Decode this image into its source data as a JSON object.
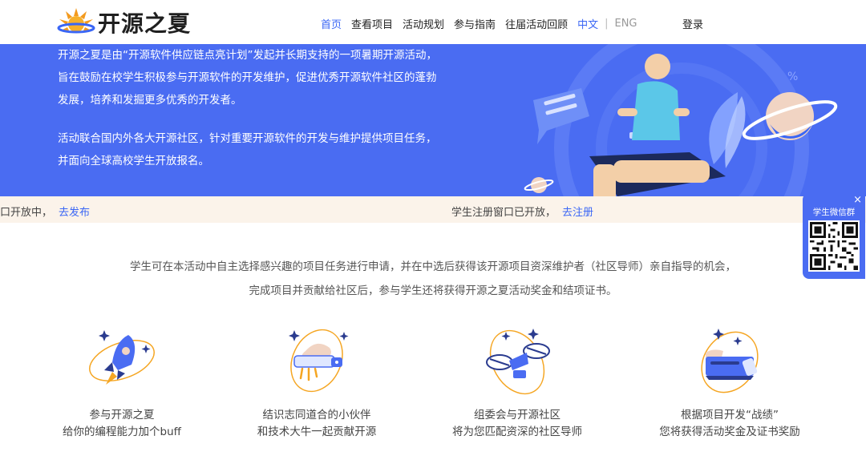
{
  "header": {
    "logo_text": "开源之夏",
    "nav": [
      "首页",
      "查看项目",
      "活动规划",
      "参与指南",
      "往届活动回顾"
    ],
    "active_index": 0,
    "lang_zh": "中文",
    "lang_sep": "|",
    "lang_en": "ENG",
    "login": "登录"
  },
  "hero": {
    "paragraphs": [
      "开源之夏是由“开源软件供应链点亮计划”发起并长期支持的一项暑期开源活动，旨在鼓励在校学生积极参与开源软件的开发维护，促进优秀开源软件社区的蓬勃发展，培养和发掘更多优秀的开发者。",
      "活动联合国内外各大开源社区，针对重要开源软件的开发与维护提供项目任务，并面向全球高校学生开放报名。"
    ]
  },
  "notice": {
    "left_text": "口开放中，",
    "left_link": "去发布",
    "right_text": "学生注册窗口已开放，",
    "right_link": "去注册"
  },
  "wechat": {
    "title": "学生微信群",
    "close": "×"
  },
  "intro": {
    "line1": "学生可在本活动中自主选择感兴趣的项目任务进行申请，并在中选后获得该开源项目资深维护者（社区导师）亲自指导的机会，",
    "line2": "完成项目并贡献给社区后，参与学生还将获得开源之夏活动奖金和结项证书。"
  },
  "features": [
    {
      "icon": "rocket-icon",
      "line1": "参与开源之夏",
      "line2": "给你的编程能力加个buff"
    },
    {
      "icon": "satellite-icon",
      "line1": "结识志同道合的小伙伴",
      "line2": "和技术大牛一起贡献开源"
    },
    {
      "icon": "drone-icon",
      "line1": "组委会与开源社区",
      "line2": "将为您匹配资深的社区导师"
    },
    {
      "icon": "spaceship-icon",
      "line1": "根据项目开发“战绩”",
      "line2": "您将获得活动奖金及证书奖励"
    }
  ],
  "colors": {
    "brand_blue": "#4a6cf2",
    "link_blue": "#3a66f5",
    "notice_bg": "#fbf3ea",
    "accent_orange": "#f5a623"
  }
}
